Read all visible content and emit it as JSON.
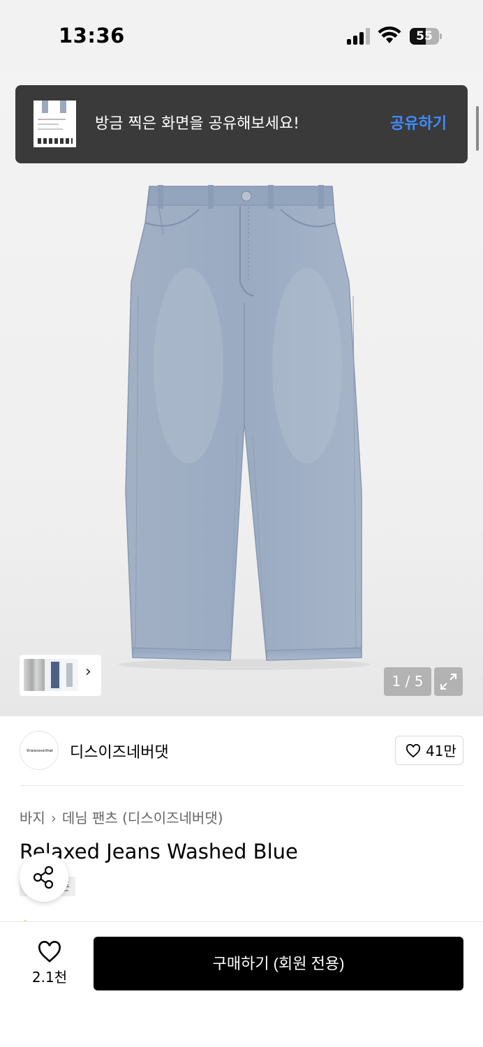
{
  "status_bar": {
    "time": "13:36",
    "battery": "55",
    "battery_level": 0.55
  },
  "toast": {
    "message": "방금 찍은 화면을 공유해보세요!",
    "action": "공유하기"
  },
  "gallery": {
    "counter": "1 / 5",
    "expand_icon": "expand-icon",
    "thumbnail_next_icon": "chevron-right-icon"
  },
  "brand": {
    "logo_text": "thisisneverthat",
    "name": "디스이즈네버댓",
    "likes": "41만"
  },
  "product": {
    "breadcrumb": [
      "바지",
      "데님 팬츠 (디스이즈네버댓)"
    ],
    "title": "Relaxed Jeans Washed Blue",
    "tag": "쿠폰"
  },
  "bottom_bar": {
    "wish_count": "2.1천",
    "buy_label": "구매하기 (회원 전용)"
  },
  "colors": {
    "toast_bg": "#3a3a3a",
    "toast_action": "#3f8bff",
    "denim": "#9fb0c7",
    "buy_bg": "#000000"
  }
}
